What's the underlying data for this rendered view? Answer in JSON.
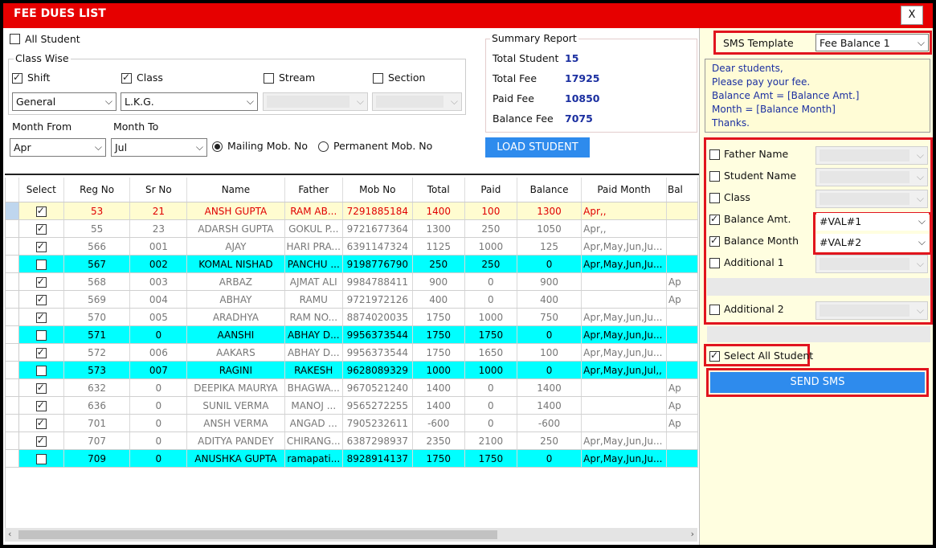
{
  "window": {
    "title": "FEE DUES LIST",
    "close_label": "X"
  },
  "filters": {
    "all_student_label": "All Student",
    "class_wise_label": "Class Wise",
    "shift_label": "Shift",
    "class_label": "Class",
    "stream_label": "Stream",
    "section_label": "Section",
    "shift_value": "General",
    "class_value": "L.K.G.",
    "month_from_label": "Month From",
    "month_to_label": "Month To",
    "month_from_value": "Apr",
    "month_to_value": "Jul",
    "mailing_label": "Mailing Mob. No",
    "permanent_label": "Permanent Mob. No"
  },
  "summary": {
    "title": "Summary Report",
    "total_student_label": "Total Student",
    "total_student_value": "15",
    "total_fee_label": "Total Fee",
    "total_fee_value": "17925",
    "paid_fee_label": "Paid Fee",
    "paid_fee_value": "10850",
    "balance_fee_label": "Balance Fee",
    "balance_fee_value": "7075",
    "load_button": "LOAD STUDENT"
  },
  "grid": {
    "columns": [
      "Select",
      "Reg No",
      "Sr No",
      "Name",
      "Father",
      "Mob No",
      "Total",
      "Paid",
      "Balance",
      "Paid Month",
      "Bal"
    ],
    "rows": [
      {
        "checked": true,
        "style": "sel-row",
        "cells": [
          "53",
          "21",
          "ANSH GUPTA",
          "RAM AB...",
          "7291885184",
          "1400",
          "100",
          "1300",
          "Apr,,",
          ""
        ]
      },
      {
        "checked": true,
        "style": "",
        "cells": [
          "55",
          "23",
          "ADARSH GUPTA",
          "GOKUL P...",
          "9721677364",
          "1300",
          "250",
          "1050",
          "Apr,,",
          ""
        ]
      },
      {
        "checked": true,
        "style": "",
        "cells": [
          "566",
          "001",
          "AJAY",
          "HARI PRA...",
          "6391147324",
          "1125",
          "1000",
          "125",
          "Apr,May,Jun,Ju...",
          ""
        ]
      },
      {
        "checked": false,
        "style": "cyan",
        "cells": [
          "567",
          "002",
          "KOMAL NISHAD",
          "PANCHU ...",
          "9198776790",
          "250",
          "250",
          "0",
          "Apr,May,Jun,Ju...",
          ""
        ]
      },
      {
        "checked": true,
        "style": "",
        "cells": [
          "568",
          "003",
          "ARBAZ",
          "AJMAT ALI",
          "9984788411",
          "900",
          "0",
          "900",
          "",
          "Ap"
        ]
      },
      {
        "checked": true,
        "style": "",
        "cells": [
          "569",
          "004",
          "ABHAY",
          "RAMU",
          "9721972126",
          "400",
          "0",
          "400",
          "",
          "Ap"
        ]
      },
      {
        "checked": true,
        "style": "",
        "cells": [
          "570",
          "005",
          "ARADHYA",
          "RAM NO...",
          "8874020035",
          "1750",
          "1000",
          "750",
          "Apr,May,Jun,Ju...",
          ""
        ]
      },
      {
        "checked": false,
        "style": "cyan",
        "cells": [
          "571",
          "0",
          "AANSHI",
          "ABHAY D...",
          "9956373544",
          "1750",
          "1750",
          "0",
          "Apr,May,Jun,Ju...",
          ""
        ]
      },
      {
        "checked": true,
        "style": "",
        "cells": [
          "572",
          "006",
          "AAKARS",
          "ABHAY D...",
          "9956373544",
          "1750",
          "1650",
          "100",
          "Apr,May,Jun,Ju...",
          ""
        ]
      },
      {
        "checked": false,
        "style": "cyan",
        "cells": [
          "573",
          "007",
          "RAGINI",
          "RAKESH",
          "9628089329",
          "1000",
          "1000",
          "0",
          "Apr,May,Jun,Jul,,",
          ""
        ]
      },
      {
        "checked": true,
        "style": "",
        "cells": [
          "632",
          "0",
          "DEEPIKA MAURYA",
          "BHAGWA...",
          "9670521240",
          "1400",
          "0",
          "1400",
          "",
          "Ap"
        ]
      },
      {
        "checked": true,
        "style": "",
        "cells": [
          "636",
          "0",
          "SUNIL VERMA",
          "MANOJ ...",
          "9565272255",
          "1400",
          "0",
          "1400",
          "",
          "Ap"
        ]
      },
      {
        "checked": true,
        "style": "",
        "cells": [
          "701",
          "0",
          "ANSH VERMA",
          "ANGAD ...",
          "7905232611",
          "-600",
          "0",
          "-600",
          "",
          "Ap"
        ]
      },
      {
        "checked": true,
        "style": "",
        "cells": [
          "707",
          "0",
          "ADITYA PANDEY",
          "CHIRANG...",
          "6387298937",
          "2350",
          "2100",
          "250",
          "Apr,May,Jun,Ju...",
          ""
        ]
      },
      {
        "checked": false,
        "style": "cyan",
        "cells": [
          "709",
          "0",
          "ANUSHKA GUPTA",
          "ramapati...",
          "8928914137",
          "1750",
          "1750",
          "0",
          "Apr,May,Jun,Ju...",
          ""
        ]
      }
    ]
  },
  "sms": {
    "template_label": "SMS Template",
    "template_value": "Fee Balance 1",
    "message_lines": [
      "Dear students,",
      "Please pay your fee.",
      "Balance Amt = [Balance Amt.]",
      "Month = [Balance Month]",
      "Thanks."
    ],
    "father_name_label": "Father Name",
    "student_name_label": "Student Name",
    "class_label": "Class",
    "balance_amt_label": "Balance Amt.",
    "balance_amt_value": "#VAL#1",
    "balance_month_label": "Balance Month",
    "balance_month_value": "#VAL#2",
    "additional1_label": "Additional 1",
    "additional2_label": "Additional 2",
    "select_all_label": "Select All Student",
    "send_button": "SEND SMS"
  },
  "colors": {
    "title_bar": "#e60000",
    "highlight_box": "#e1141e",
    "button": "#2e8bed",
    "paid_row": "#00ffff",
    "selected_row": "#fffcd0"
  }
}
